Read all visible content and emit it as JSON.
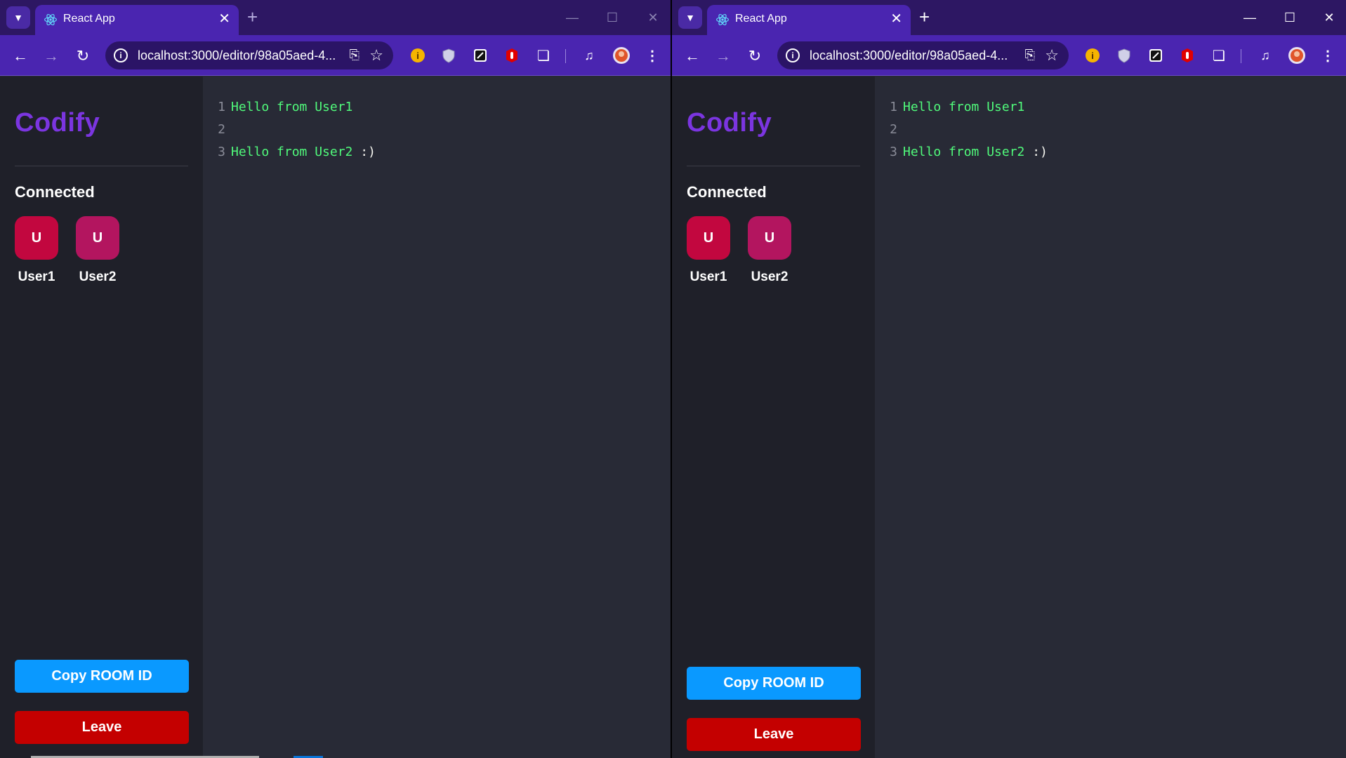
{
  "windows": [
    {
      "tab": {
        "title": "React App"
      },
      "address": {
        "url": "localhost:3000/editor/98a05aed-4..."
      },
      "app": {
        "logo": "Codify",
        "connected_label": "Connected",
        "clients": [
          {
            "initial": "U",
            "name": "User1",
            "color": "#c2073f"
          },
          {
            "initial": "U",
            "name": "User2",
            "color": "#b3155f"
          }
        ],
        "copy_button": "Copy ROOM ID",
        "leave_button": "Leave"
      },
      "editor": {
        "lines": [
          {
            "num": "1",
            "text": "Hello from User1",
            "tail": ""
          },
          {
            "num": "2",
            "text": "",
            "tail": ""
          },
          {
            "num": "3",
            "text": "Hello from User2",
            "tail": " :)"
          }
        ]
      }
    },
    {
      "tab": {
        "title": "React App"
      },
      "address": {
        "url": "localhost:3000/editor/98a05aed-4..."
      },
      "app": {
        "logo": "Codify",
        "connected_label": "Connected",
        "clients": [
          {
            "initial": "U",
            "name": "User1",
            "color": "#c2073f"
          },
          {
            "initial": "U",
            "name": "User2",
            "color": "#b3155f"
          }
        ],
        "copy_button": "Copy ROOM ID",
        "leave_button": "Leave"
      },
      "editor": {
        "lines": [
          {
            "num": "1",
            "text": "Hello from User1",
            "tail": ""
          },
          {
            "num": "2",
            "text": "",
            "tail": ""
          },
          {
            "num": "3",
            "text": "Hello from User2",
            "tail": " :)"
          }
        ]
      }
    }
  ],
  "icons": {
    "tab_list": "chevron-down-icon",
    "back": "arrow-left-icon",
    "forward": "arrow-right-icon",
    "reload": "reload-icon",
    "extensions": [
      "yellow-extension-icon",
      "shield-extension-icon",
      "black-extension-icon",
      "red-hand-extension-icon",
      "puzzle-extensions-icon",
      "media-control-icon",
      "profile-avatar-icon",
      "more-menu-icon"
    ]
  },
  "colors": {
    "tab_strip": "#2d1763",
    "toolbar": "#4a25b0",
    "logo": "#7b35e0",
    "sidebar": "#1f2029",
    "editor": "#282a36",
    "code_text": "#50fa7b",
    "copy_button": "#0a99ff",
    "leave_button": "#c40000"
  }
}
